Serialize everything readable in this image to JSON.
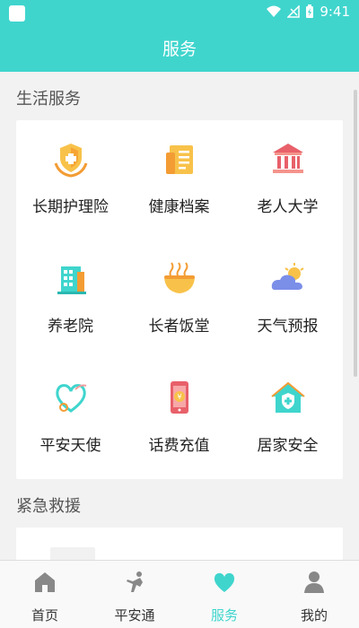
{
  "status_bar": {
    "time": "9:41"
  },
  "header": {
    "title": "服务"
  },
  "sections": {
    "life_services": {
      "title": "生活服务",
      "items": [
        {
          "label": "长期护理险",
          "icon": "shield-hands-icon"
        },
        {
          "label": "健康档案",
          "icon": "document-icon"
        },
        {
          "label": "老人大学",
          "icon": "university-icon"
        },
        {
          "label": "养老院",
          "icon": "building-icon"
        },
        {
          "label": "长者饭堂",
          "icon": "noodle-bowl-icon"
        },
        {
          "label": "天气预报",
          "icon": "weather-icon"
        },
        {
          "label": "平安天使",
          "icon": "heart-angel-icon"
        },
        {
          "label": "话费充值",
          "icon": "phone-recharge-icon"
        },
        {
          "label": "居家安全",
          "icon": "home-safety-icon"
        }
      ]
    },
    "emergency": {
      "title": "紧急救援"
    }
  },
  "bottom_nav": [
    {
      "label": "首页",
      "icon": "home-icon"
    },
    {
      "label": "平安通",
      "icon": "runner-icon"
    },
    {
      "label": "服务",
      "icon": "heart-icon"
    },
    {
      "label": "我的",
      "icon": "user-icon"
    }
  ],
  "colors": {
    "accent": "#3fd5cd",
    "background": "#f2f2f2"
  }
}
